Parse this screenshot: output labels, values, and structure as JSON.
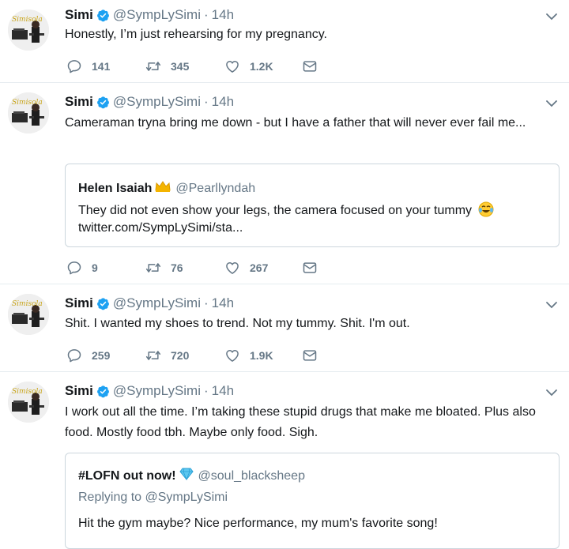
{
  "tweets": [
    {
      "name": "Simi",
      "handle": "@SympLySimi",
      "time": "14h",
      "text": "Honestly, I’m just rehearsing for my pregnancy.",
      "replies": "141",
      "retweets": "345",
      "likes": "1.2K"
    },
    {
      "name": "Simi",
      "handle": "@SympLySimi",
      "time": "14h",
      "text": "Cameraman tryna bring me down - but I have a father that will never ever fail me...",
      "replies": "9",
      "retweets": "76",
      "likes": "267",
      "quote": {
        "name": "Helen Isaiah",
        "handle": "@Pearllyndah",
        "text": "They did not even show your legs, the camera focused on your tummy",
        "link": "twitter.com/SympLySimi/sta..."
      }
    },
    {
      "name": "Simi",
      "handle": "@SympLySimi",
      "time": "14h",
      "text": "Shit. I wanted my shoes to trend. Not my tummy. Shit. I'm out.",
      "replies": "259",
      "retweets": "720",
      "likes": "1.9K"
    },
    {
      "name": "Simi",
      "handle": "@SympLySimi",
      "time": "14h",
      "text": "I work out all the time. I’m taking these stupid drugs that make me bloated. Plus also food. Mostly food tbh. Maybe only food. Sigh.",
      "quote": {
        "name": "#LOFN out now!",
        "handle": "@soul_blacksheep",
        "replying": "Replying to @SympLySimi",
        "text": "Hit the gym maybe? Nice performance, my mum's favorite song!"
      }
    }
  ],
  "separator": "·",
  "avatar_text": "Simisola",
  "colors": {
    "verified": "#1da1f2",
    "muted": "#657786",
    "border": "#e6ecf0",
    "text": "#14171a"
  },
  "icons": [
    "avatar",
    "verified-badge-icon",
    "chevron-down-icon",
    "reply-icon",
    "retweet-icon",
    "like-icon",
    "direct-message-icon",
    "crown-emoji-icon",
    "tears-of-joy-emoji-icon",
    "gem-emoji-icon"
  ]
}
